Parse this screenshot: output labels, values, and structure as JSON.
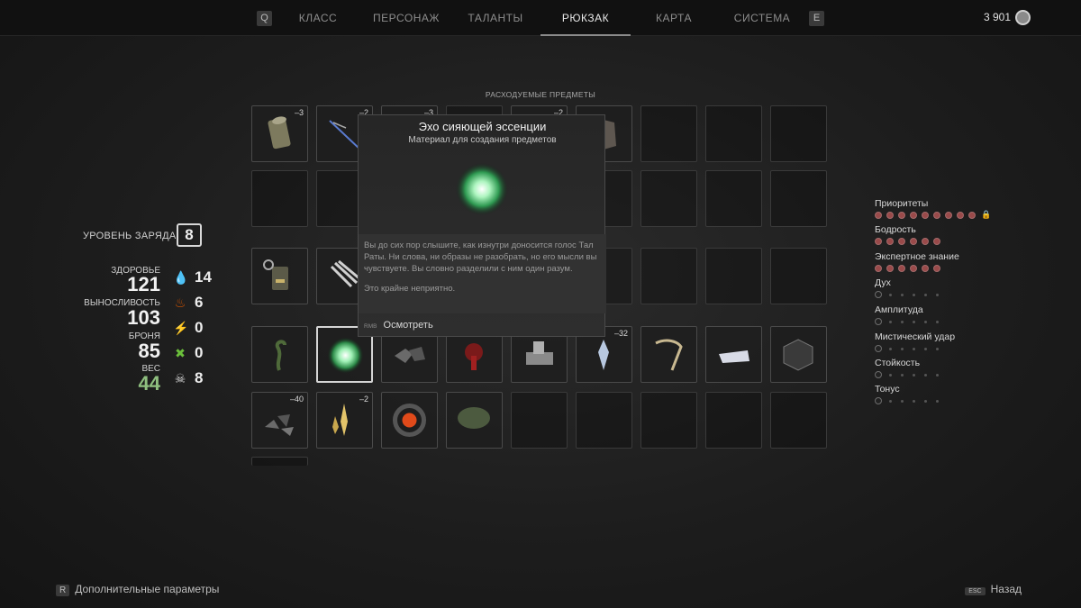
{
  "nav": {
    "left_key": "Q",
    "right_key": "E",
    "tabs": [
      {
        "label": "КЛАСС"
      },
      {
        "label": "ПЕРСОНАЖ"
      },
      {
        "label": "ТАЛАНТЫ"
      },
      {
        "label": "РЮКЗАК",
        "active": true
      },
      {
        "label": "КАРТА"
      },
      {
        "label": "СИСТЕМА"
      }
    ],
    "currency": "3 901",
    "currency_icon": "scrap-coin-icon"
  },
  "inventory": {
    "section_label": "РАСХОДУЕМЫЕ ПРЕДМЕТЫ",
    "quantities": {
      "r0c0": "3",
      "r0c1": "2",
      "r0c2": "3",
      "r0c4": "2",
      "r3c5": "32",
      "r4c0": "40",
      "r4c1": "2"
    },
    "selected_slot": "r3c1"
  },
  "stats": {
    "charge_label": "УРОВЕНЬ ЗАРЯДА",
    "charge_value": "8",
    "health_label": "ЗДОРОВЬЕ",
    "health_value": "121",
    "stamina_label": "ВЫНОСЛИВОСТЬ",
    "stamina_value": "103",
    "armor_label": "БРОНЯ",
    "armor_value": "85",
    "weight_label": "ВЕС",
    "weight_value": "44",
    "resistances": [
      {
        "icon": "bleed-icon",
        "value": "14",
        "color": "#c0392b"
      },
      {
        "icon": "fire-icon",
        "value": "6",
        "color": "#d35400"
      },
      {
        "icon": "shock-icon",
        "value": "0",
        "color": "#6c6cff"
      },
      {
        "icon": "acid-icon",
        "value": "0",
        "color": "#6bbf3b"
      },
      {
        "icon": "blight-icon",
        "value": "8",
        "color": "#d8d8d8"
      }
    ]
  },
  "traits": [
    {
      "name": "Приоритеты",
      "filled": 9,
      "total": 9,
      "locked": true
    },
    {
      "name": "Бодрость",
      "filled": 6,
      "total": 6
    },
    {
      "name": "Экспертное знание",
      "filled": 6,
      "total": 6
    },
    {
      "name": "Дух",
      "filled": 0,
      "total": 1
    },
    {
      "name": "Амплитуда",
      "filled": 0,
      "total": 1
    },
    {
      "name": "Мистический удар",
      "filled": 0,
      "total": 1
    },
    {
      "name": "Стойкость",
      "filled": 0,
      "total": 1
    },
    {
      "name": "Тонус",
      "filled": 0,
      "total": 1
    }
  ],
  "tooltip": {
    "title": "Эхо сияющей эссенции",
    "subtitle": "Материал для создания предметов",
    "description": "Вы до сих пор слышите, как изнутри доносится голос Тал Раты. Ни слова, ни образы не разобрать, но его мысли вы чувствуете. Вы словно разделили с ним один разум.",
    "flavor": "Это крайне неприятно.",
    "action_key": "RMB",
    "action_label": "Осмотреть"
  },
  "footer": {
    "left_key": "R",
    "left_label": "Дополнительные параметры",
    "right_key": "ESC",
    "right_label": "Назад"
  },
  "colors": {
    "accent_green": "#8fbf7f",
    "essence_glow": "#3ecf6a",
    "trait_dot": "#9a4a4a"
  }
}
